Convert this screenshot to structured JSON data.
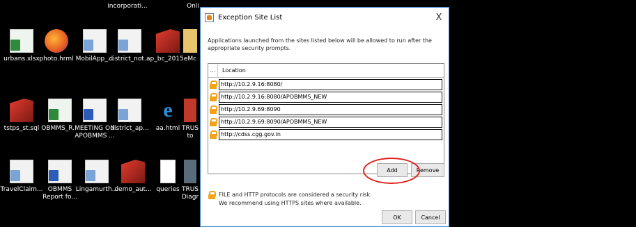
{
  "desktop": {
    "top_row": [
      "incorporati...",
      "Onli"
    ],
    "icons": [
      {
        "label": "urbans.xlsx",
        "icon": "excel-file-icon"
      },
      {
        "label": "photo.hrml",
        "icon": "firefox-icon"
      },
      {
        "label": "MobilApp_...",
        "icon": "doc-file-icon"
      },
      {
        "label": "district_not...",
        "icon": "doc-file-icon"
      },
      {
        "label": "ap_bc_2015...",
        "icon": "sql-file-icon"
      },
      {
        "label": "eMc",
        "icon": "folder-icon"
      },
      {
        "label": "tstps_st.sql",
        "icon": "sql-file-icon"
      },
      {
        "label": "OBMMS_R...",
        "icon": "excel-file-icon"
      },
      {
        "label": "MEETING ON\nAPOBMMS ...",
        "icon": "word-file-icon"
      },
      {
        "label": "district_ap...",
        "icon": "doc-file-icon"
      },
      {
        "label": "aa.html",
        "icon": "ie-icon"
      },
      {
        "label": "TRUS\nto",
        "icon": "app-icon"
      },
      {
        "label": "TravelClaim...",
        "icon": "doc-file-icon"
      },
      {
        "label": "OBMMS\nReport fo...",
        "icon": "word-file-icon"
      },
      {
        "label": "Lingamurth...",
        "icon": "doc-file-icon"
      },
      {
        "label": "demo_aut...",
        "icon": "sql-file-icon"
      },
      {
        "label": "queries",
        "icon": "text-file-icon"
      },
      {
        "label": "TRUS\nDiagr",
        "icon": "app-icon"
      }
    ]
  },
  "dialog": {
    "title": "Exception Site List",
    "close_glyph": "X",
    "description": "Applications launched from the sites listed below will be allowed to run after the appropriate security prompts.",
    "table": {
      "col_dots": "...",
      "col_location": "Location",
      "rows": [
        "http://10.2.9.16:8080/",
        "http://10.2.9.16:8080/APOBMMS_NEW",
        "http://10.2.9.69:8090",
        "http://10.2.9.69:8090/APOBMMS_NEW",
        "http://cdss.cgg.gov.in"
      ]
    },
    "add_label": "Add",
    "remove_label": "Remove",
    "note_line1": "FILE and HTTP protocols are considered a security risk.",
    "note_line2": "We recommend using HTTPS sites where available.",
    "ok_label": "OK",
    "cancel_label": "Cancel"
  },
  "colors": {
    "accent": "#3a84d3",
    "highlight": "#e0201a",
    "lock": "#f3a317"
  }
}
